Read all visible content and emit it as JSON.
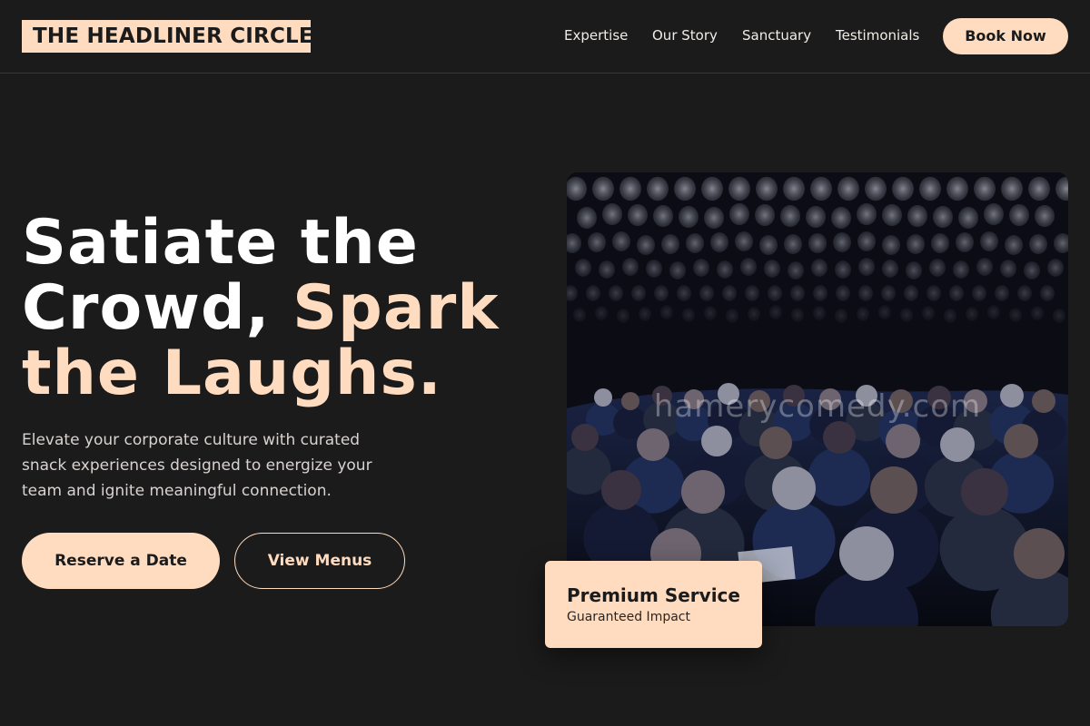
{
  "brand": {
    "name": "THE HEADLINER CIRCLE"
  },
  "nav": {
    "items": [
      {
        "label": "Expertise"
      },
      {
        "label": "Our Story"
      },
      {
        "label": "Sanctuary"
      },
      {
        "label": "Testimonials"
      }
    ],
    "cta_label": "Book Now"
  },
  "hero": {
    "title_line1": "Satiate the",
    "title_line2_white": "Crowd, ",
    "title_line2_accent": "Spark",
    "title_line3": "the Laughs.",
    "subtitle": "Elevate your corporate culture with curated snack experiences designed to energize your team and ignite meaningful connection.",
    "primary_button": "Reserve a Date",
    "secondary_button": "View Menus"
  },
  "photo": {
    "watermark": "hamerycomedy.com"
  },
  "card": {
    "title": "Premium Service",
    "subtitle": "Guaranteed Impact"
  },
  "colors": {
    "background": "#1c1b1b",
    "accent": "#ffdcbf",
    "text": "#ffffff",
    "muted_text": "#d8d3d0"
  }
}
